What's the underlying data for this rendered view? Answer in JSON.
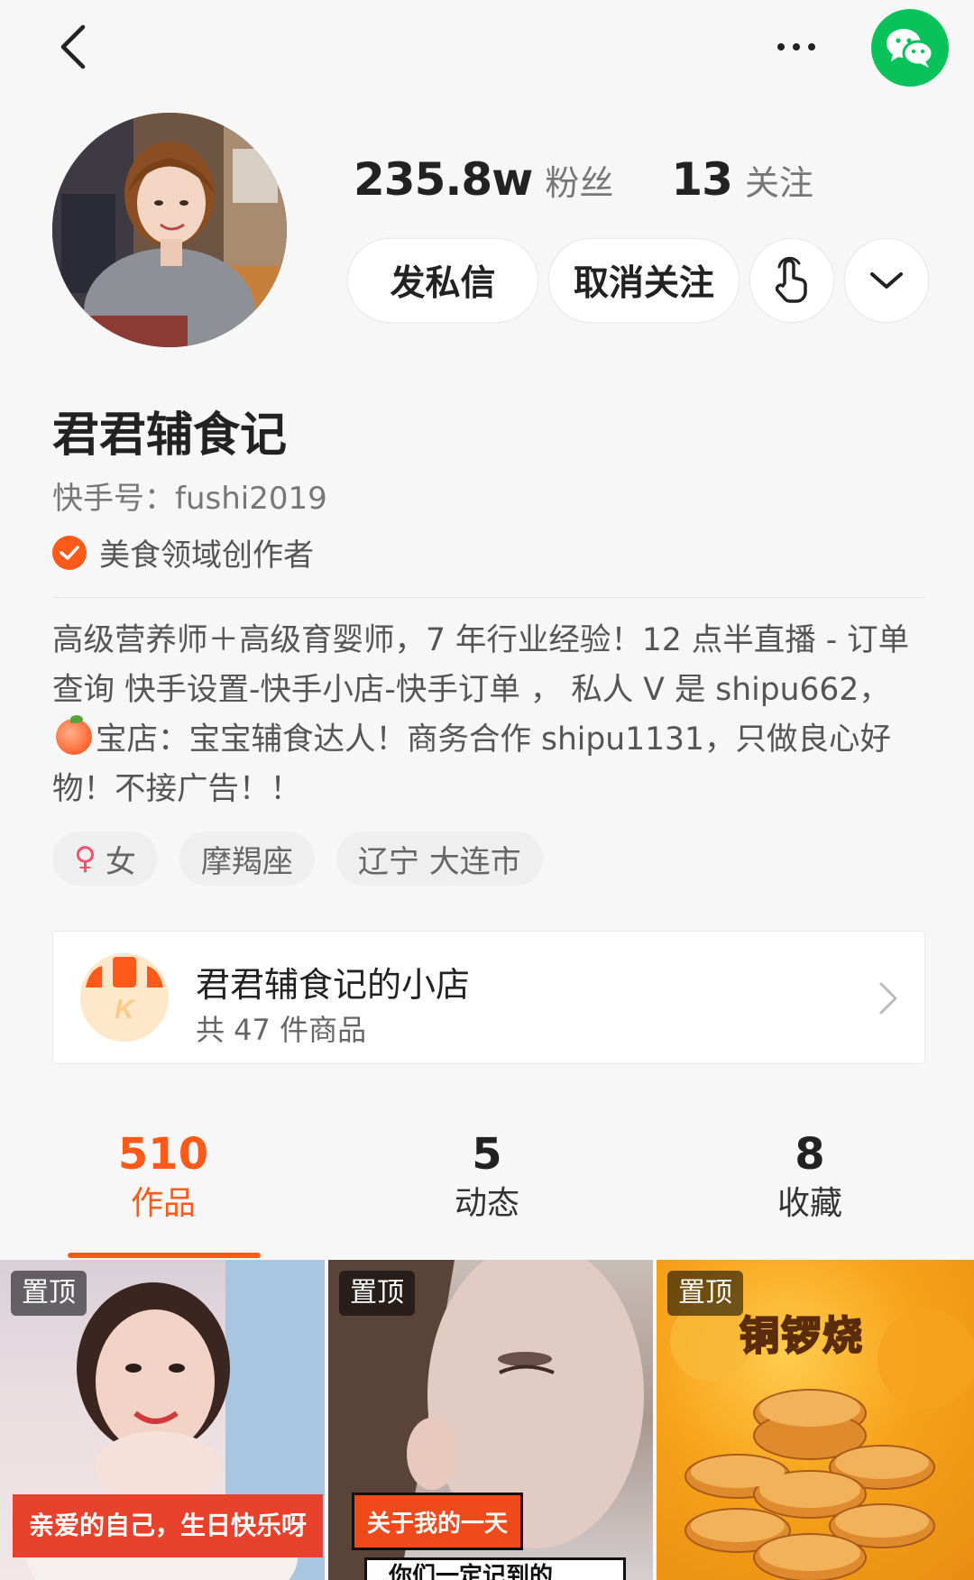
{
  "header": {
    "back_icon": "chevron-left-icon",
    "more_icon": "more-horizontal-icon",
    "share_icon": "wechat-icon",
    "wechat_color": "#09c25a"
  },
  "profile": {
    "followers_count": "235.8w",
    "followers_label": "粉丝",
    "following_count": "13",
    "following_label": "关注",
    "name": "君君辅食记",
    "kuaishou_id": "快手号：fushi2019",
    "creator_badge": "美食领域创作者",
    "bio_part1": "高级营养师＋高级育婴师，7 年行业经验！12 点半直播 - 订单查询 快手设置-快手小店-快手订单 ，  私人 V 是 shipu662，",
    "bio_emoji": "peach",
    "bio_part2": "宝店：宝宝辅食达人！商务合作 shipu1131，只做良心好物！不接广告！！",
    "tags": {
      "gender": "女",
      "gender_icon": "female-icon",
      "zodiac": "摩羯座",
      "location": "辽宁 大连市"
    }
  },
  "actions": {
    "message_label": "发私信",
    "unfollow_label": "取消关注",
    "poke_icon": "hand-tap-icon",
    "dropdown_icon": "chevron-down-icon"
  },
  "shop": {
    "name": "君君辅食记的小店",
    "count": "共 47 件商品",
    "logo_icon": "shop-logo-icon"
  },
  "tabs": [
    {
      "count": "510",
      "label": "作品",
      "active": true
    },
    {
      "count": "5",
      "label": "动态",
      "active": false
    },
    {
      "count": "8",
      "label": "收藏",
      "active": false
    }
  ],
  "accent_color": "#ff5a19",
  "thumbnails": [
    {
      "pin": "置顶",
      "caption": "亲爱的自己，生日快乐呀"
    },
    {
      "pin": "置顶",
      "caption": "关于我的一天",
      "caption2": "你们一定记到的"
    },
    {
      "pin": "置顶",
      "title": "铜锣烧"
    }
  ]
}
